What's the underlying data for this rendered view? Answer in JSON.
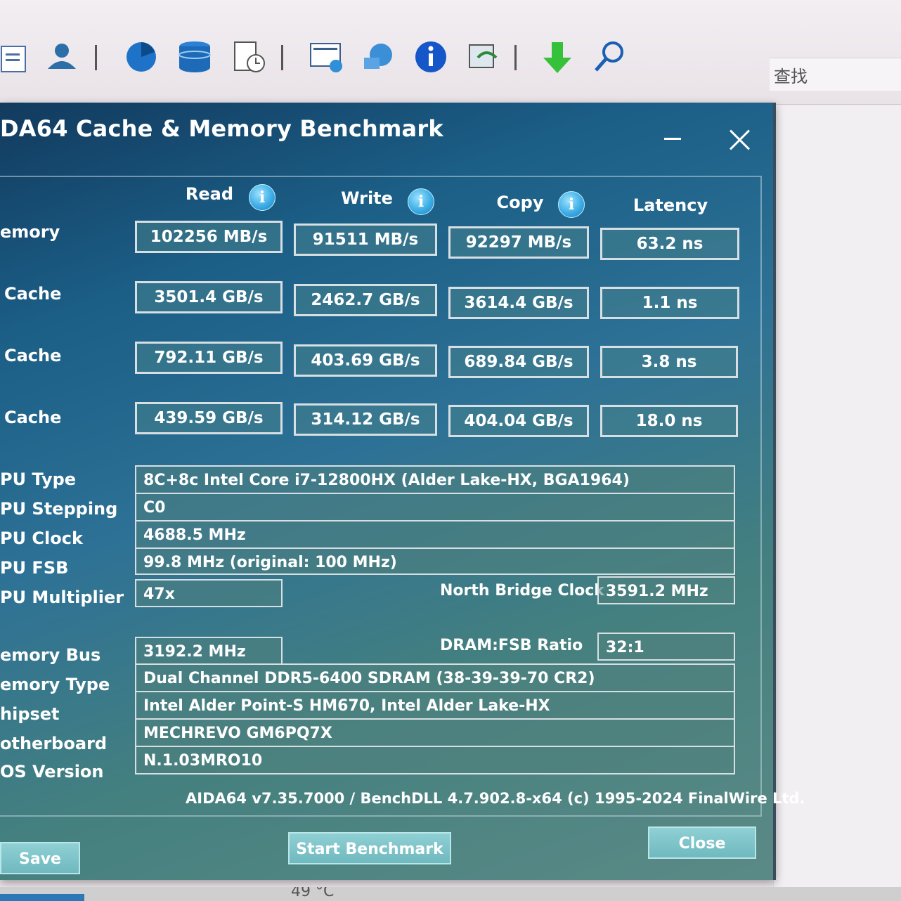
{
  "toolbar": {
    "icons": [
      "report-icon",
      "user-icon",
      "chart-icon",
      "database-icon",
      "scheduler-icon",
      "network-report-icon",
      "remote-icon",
      "info-icon",
      "audit-icon",
      "download-icon",
      "search-icon"
    ],
    "search_label": "查找"
  },
  "window": {
    "title": "DA64 Cache & Memory Benchmark"
  },
  "columns": {
    "read": "Read",
    "write": "Write",
    "copy": "Copy",
    "latency": "Latency"
  },
  "rows": {
    "memory": {
      "label": "emory",
      "read": "102256 MB/s",
      "write": "91511 MB/s",
      "copy": "92297 MB/s",
      "latency": "63.2 ns"
    },
    "l1": {
      "label": "Cache",
      "read": "3501.4 GB/s",
      "write": "2462.7 GB/s",
      "copy": "3614.4 GB/s",
      "latency": "1.1 ns"
    },
    "l2": {
      "label": "Cache",
      "read": "792.11 GB/s",
      "write": "403.69 GB/s",
      "copy": "689.84 GB/s",
      "latency": "3.8 ns"
    },
    "l3": {
      "label": "Cache",
      "read": "439.59 GB/s",
      "write": "314.12 GB/s",
      "copy": "404.04 GB/s",
      "latency": "18.0 ns"
    }
  },
  "info": {
    "cpu_type_label": "PU Type",
    "cpu_type": "8C+8c Intel Core i7-12800HX  (Alder Lake-HX, BGA1964)",
    "cpu_stepping_label": "PU Stepping",
    "cpu_stepping": "C0",
    "cpu_clock_label": "PU Clock",
    "cpu_clock": "4688.5 MHz",
    "cpu_fsb_label": "PU FSB",
    "cpu_fsb": "99.8 MHz  (original: 100 MHz)",
    "cpu_multiplier_label": "PU Multiplier",
    "cpu_multiplier": "47x",
    "nb_clock_label": "North Bridge Clock",
    "nb_clock": "3591.2 MHz",
    "memory_bus_label": "emory Bus",
    "memory_bus": "3192.2 MHz",
    "dram_ratio_label": "DRAM:FSB Ratio",
    "dram_ratio": "32:1",
    "memory_type_label": "emory Type",
    "memory_type": "Dual Channel DDR5-6400 SDRAM  (38-39-39-70 CR2)",
    "chipset_label": "hipset",
    "chipset": "Intel Alder Point-S HM670, Intel Alder Lake-HX",
    "motherboard_label": "otherboard",
    "motherboard": "MECHREVO GM6PQ7X",
    "bios_label": "OS Version",
    "bios": "N.1.03MRO10"
  },
  "footer": "AIDA64 v7.35.7000 / BenchDLL 4.7.902.8-x64  (c) 1995-2024 FinalWire Ltd.",
  "buttons": {
    "save": "Save",
    "start": "Start Benchmark",
    "close": "Close"
  },
  "status_strip": "49 °C"
}
